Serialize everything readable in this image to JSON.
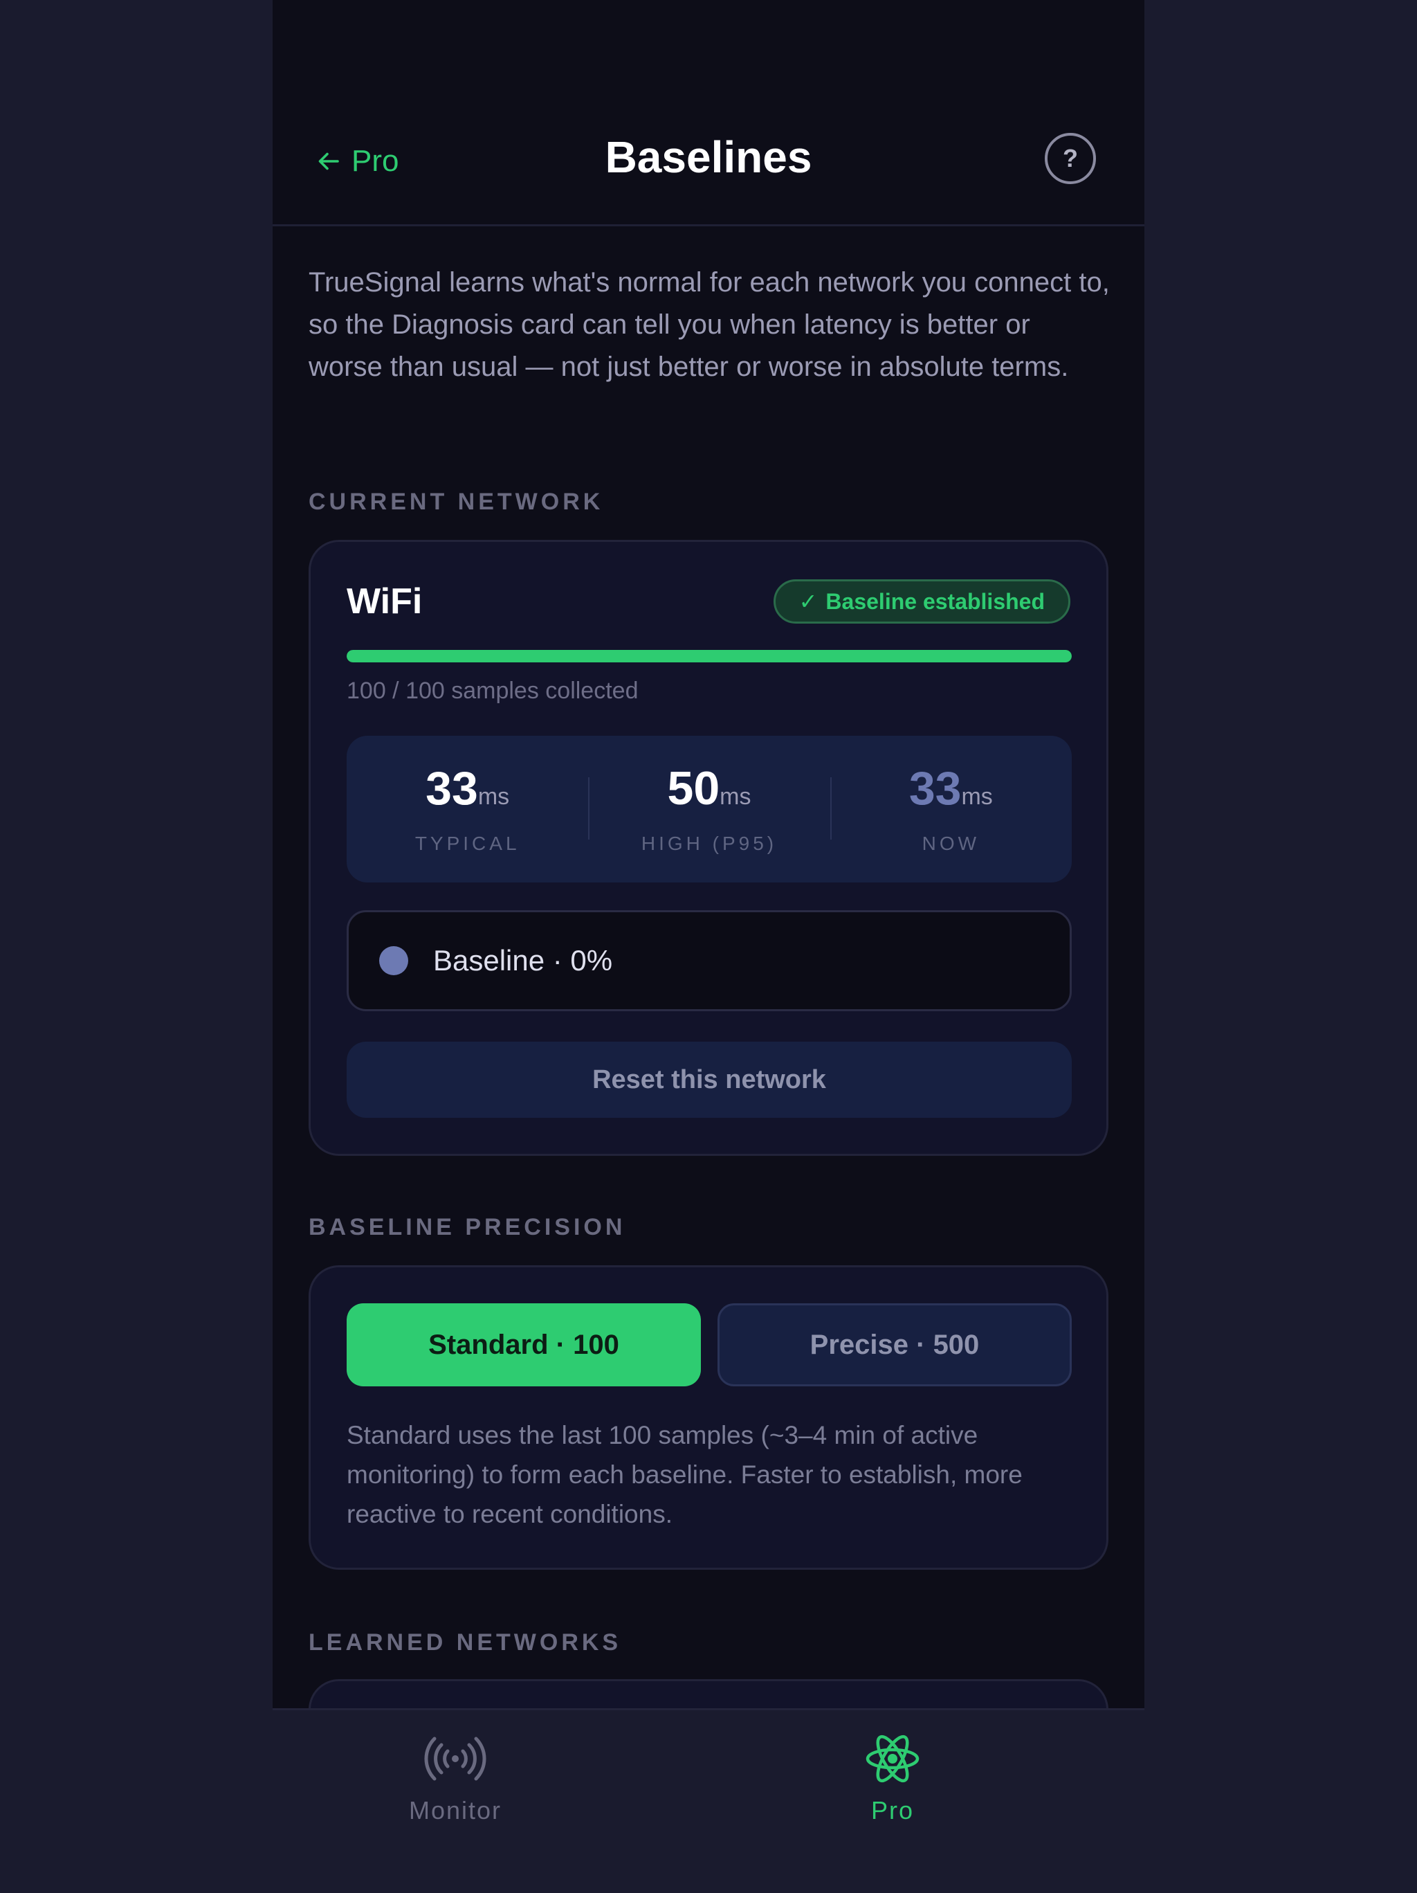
{
  "header": {
    "back_label": "Pro",
    "title": "Baselines",
    "help_glyph": "?"
  },
  "intro": "TrueSignal learns what's normal for each network you connect to, so the Diagnosis card can tell you when latency is better or worse than usual — not just better or worse in absolute terms.",
  "current_network": {
    "section_label": "CURRENT NETWORK",
    "name": "WiFi",
    "badge": "Baseline established",
    "progress": 1.0,
    "samples_text": "100 / 100 samples collected",
    "stats": [
      {
        "value": "33",
        "unit": "ms",
        "label": "TYPICAL"
      },
      {
        "value": "50",
        "unit": "ms",
        "label": "HIGH (P95)"
      },
      {
        "value": "33",
        "unit": "ms",
        "label": "NOW"
      }
    ],
    "status_text": "Baseline · 0%",
    "reset_label": "Reset this network"
  },
  "precision": {
    "section_label": "BASELINE PRECISION",
    "options": [
      {
        "label": "Standard · 100",
        "selected": true
      },
      {
        "label": "Precise · 500",
        "selected": false
      }
    ],
    "description": "Standard uses the last 100 samples (~3–4 min of active monitoring) to form each baseline. Faster to establish, more reactive to recent conditions."
  },
  "learned_networks": {
    "section_label": "LEARNED NETWORKS"
  },
  "tabs": [
    {
      "label": "Monitor",
      "icon": "broadcast-icon",
      "active": false
    },
    {
      "label": "Pro",
      "icon": "atom-icon",
      "active": true
    }
  ],
  "colors": {
    "accent": "#2ecc71",
    "background": "#0d0d18",
    "card": "#12132a",
    "muted": "#9b9bb4",
    "baseline_dot": "#6d7ab3"
  }
}
